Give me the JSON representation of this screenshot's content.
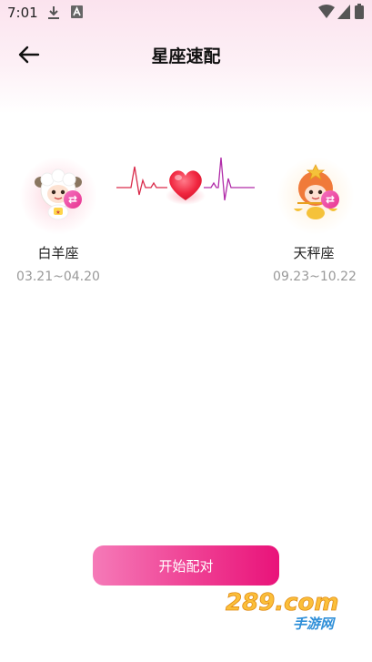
{
  "status_bar": {
    "time": "7:01"
  },
  "header": {
    "title": "星座速配"
  },
  "left_sign": {
    "name": "白羊座",
    "date_range": "03.21~04.20",
    "swap_symbol": "⇄"
  },
  "right_sign": {
    "name": "天秤座",
    "date_range": "09.23~10.22",
    "swap_symbol": "⇄"
  },
  "start_button": {
    "label": "开始配对"
  },
  "watermark": {
    "brand": "289.com",
    "subtitle": "手游网"
  },
  "colors": {
    "accent": "#ef3f93",
    "heart": "#f0263f",
    "pulse_left": "#d92a4a",
    "pulse_right": "#b02aa8"
  }
}
